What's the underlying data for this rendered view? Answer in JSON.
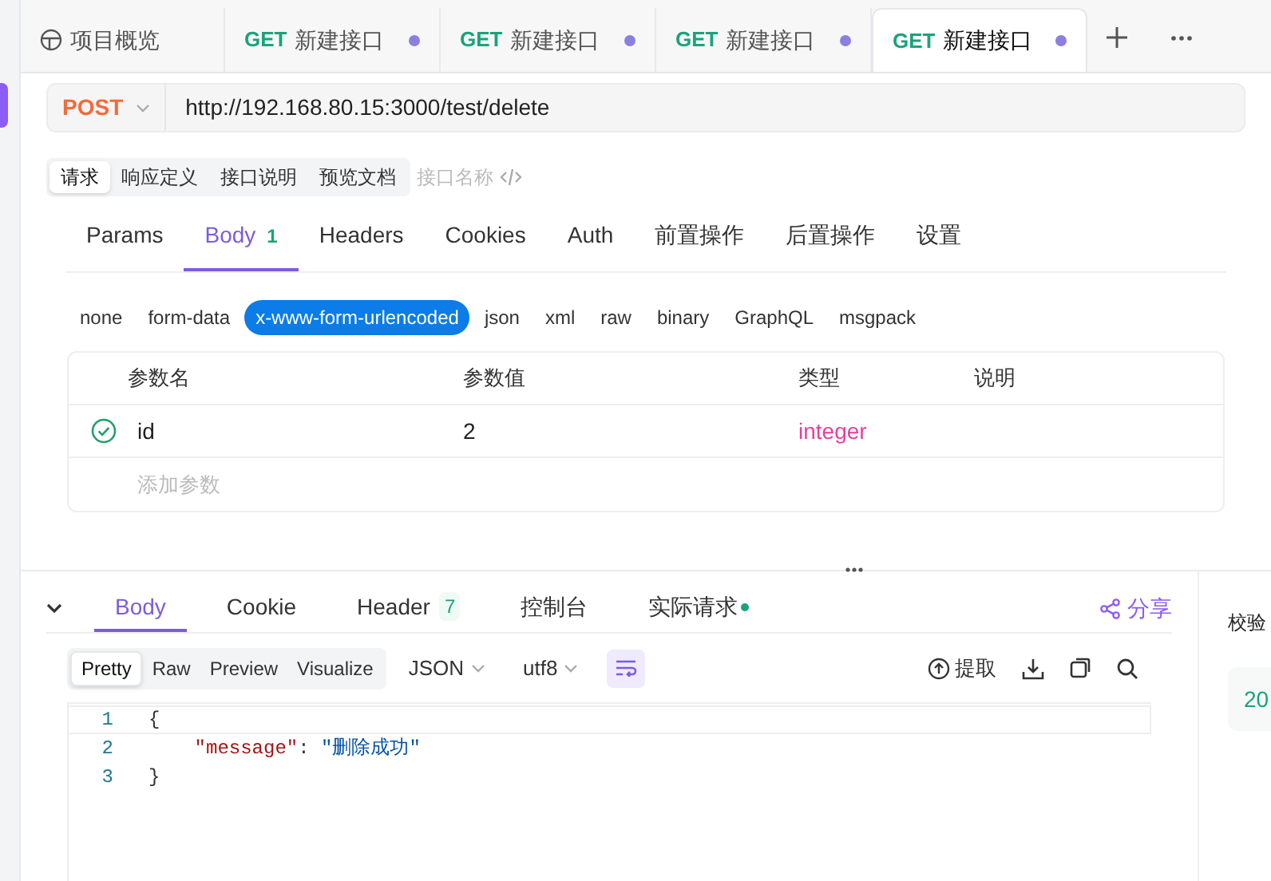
{
  "top_tabs": [
    {
      "kind": "overview",
      "label": "项目概览",
      "selected": false
    },
    {
      "kind": "request",
      "method": "GET",
      "label": "新建接口",
      "unsaved": true,
      "selected": false
    },
    {
      "kind": "request",
      "method": "GET",
      "label": "新建接口",
      "unsaved": true,
      "selected": false
    },
    {
      "kind": "request",
      "method": "GET",
      "label": "新建接口",
      "unsaved": true,
      "selected": false
    },
    {
      "kind": "request",
      "method": "GET",
      "label": "新建接口",
      "unsaved": true,
      "selected": true
    }
  ],
  "request": {
    "method": "POST",
    "url": "http://192.168.80.15:3000/test/delete"
  },
  "doc_tabs": [
    {
      "label": "请求",
      "selected": true
    },
    {
      "label": "响应定义",
      "selected": false
    },
    {
      "label": "接口说明",
      "selected": false
    },
    {
      "label": "预览文档",
      "selected": false
    }
  ],
  "name_placeholder": "接口名称",
  "request_tabs": [
    {
      "label": "Params",
      "selected": false
    },
    {
      "label": "Body",
      "count": "1",
      "selected": true
    },
    {
      "label": "Headers",
      "selected": false
    },
    {
      "label": "Cookies",
      "selected": false
    },
    {
      "label": "Auth",
      "selected": false
    },
    {
      "label": "前置操作",
      "selected": false
    },
    {
      "label": "后置操作",
      "selected": false
    },
    {
      "label": "设置",
      "selected": false
    }
  ],
  "body_types": [
    {
      "label": "none",
      "selected": false
    },
    {
      "label": "form-data",
      "selected": false
    },
    {
      "label": "x-www-form-urlencoded",
      "selected": true
    },
    {
      "label": "json",
      "selected": false
    },
    {
      "label": "xml",
      "selected": false
    },
    {
      "label": "raw",
      "selected": false
    },
    {
      "label": "binary",
      "selected": false
    },
    {
      "label": "GraphQL",
      "selected": false
    },
    {
      "label": "msgpack",
      "selected": false
    }
  ],
  "params_table": {
    "columns": [
      "参数名",
      "参数值",
      "类型",
      "说明"
    ],
    "rows": [
      {
        "enabled": true,
        "name": "id",
        "value": "2",
        "type": "integer"
      }
    ],
    "add_placeholder": "添加参数"
  },
  "response": {
    "tabs": [
      {
        "label": "Body",
        "selected": true
      },
      {
        "label": "Cookie",
        "selected": false
      },
      {
        "label": "Header",
        "count": "7",
        "selected": false
      },
      {
        "label": "控制台",
        "selected": false
      },
      {
        "label": "实际请求",
        "live": true,
        "selected": false
      }
    ],
    "share": "分享",
    "view_modes": [
      {
        "label": "Pretty",
        "selected": true
      },
      {
        "label": "Raw",
        "selected": false
      },
      {
        "label": "Preview",
        "selected": false
      },
      {
        "label": "Visualize",
        "selected": false
      }
    ],
    "format": "JSON",
    "encoding": "utf8",
    "wrap_on": true,
    "extract": "提取",
    "code": [
      {
        "number": "1",
        "tokens": [
          {
            "kind": "punct",
            "text": "{"
          }
        ]
      },
      {
        "number": "2",
        "tokens": [
          {
            "kind": "key",
            "text": "    \"message\""
          },
          {
            "kind": "punct",
            "text": ": "
          },
          {
            "kind": "string",
            "text": "\"删除成功\""
          }
        ]
      },
      {
        "number": "3",
        "tokens": [
          {
            "kind": "punct",
            "text": "}"
          }
        ]
      }
    ]
  },
  "side_panel": {
    "title": "校验",
    "value": "20"
  }
}
